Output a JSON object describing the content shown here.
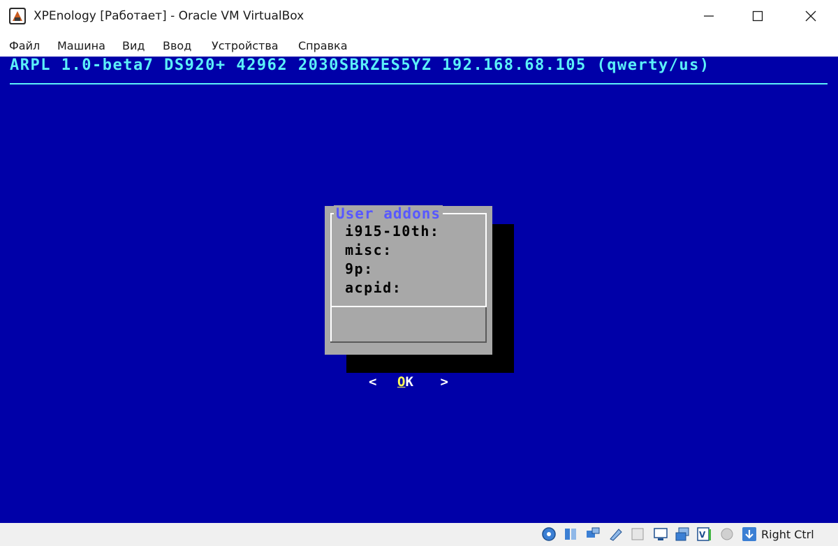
{
  "window": {
    "title": "XPEnology [Работает] - Oracle VM VirtualBox",
    "icon": "virtualbox-icon"
  },
  "menubar": {
    "items": [
      "Файл",
      "Машина",
      "Вид",
      "Ввод",
      "Устройства",
      "Справка"
    ]
  },
  "vm_screen": {
    "header": "ARPL 1.0-beta7 DS920+ 42962 2030SBRZES5YZ 192.168.68.105 (qwerty/us)",
    "colors": {
      "background": "#0000a8",
      "header": "#5cf0f8",
      "dialog": "#a8a8a8",
      "dialog_title": "#5858ff"
    },
    "dialog": {
      "title": "User addons",
      "lines": [
        "i915-10th:",
        "misc:",
        "9p:",
        "acpid:"
      ],
      "button": {
        "left": "<",
        "hotkey": "O",
        "rest": "K",
        "right": ">"
      }
    }
  },
  "statusbar": {
    "icons": [
      "hard-disk-icon",
      "optical-drive-icon",
      "audio-icon",
      "network-icon",
      "usb-icon",
      "shared-folder-icon",
      "display-icon",
      "recording-icon",
      "cpu-icon",
      "mouse-integration-icon",
      "keyboard-icon"
    ],
    "host_key": "Right Ctrl"
  }
}
